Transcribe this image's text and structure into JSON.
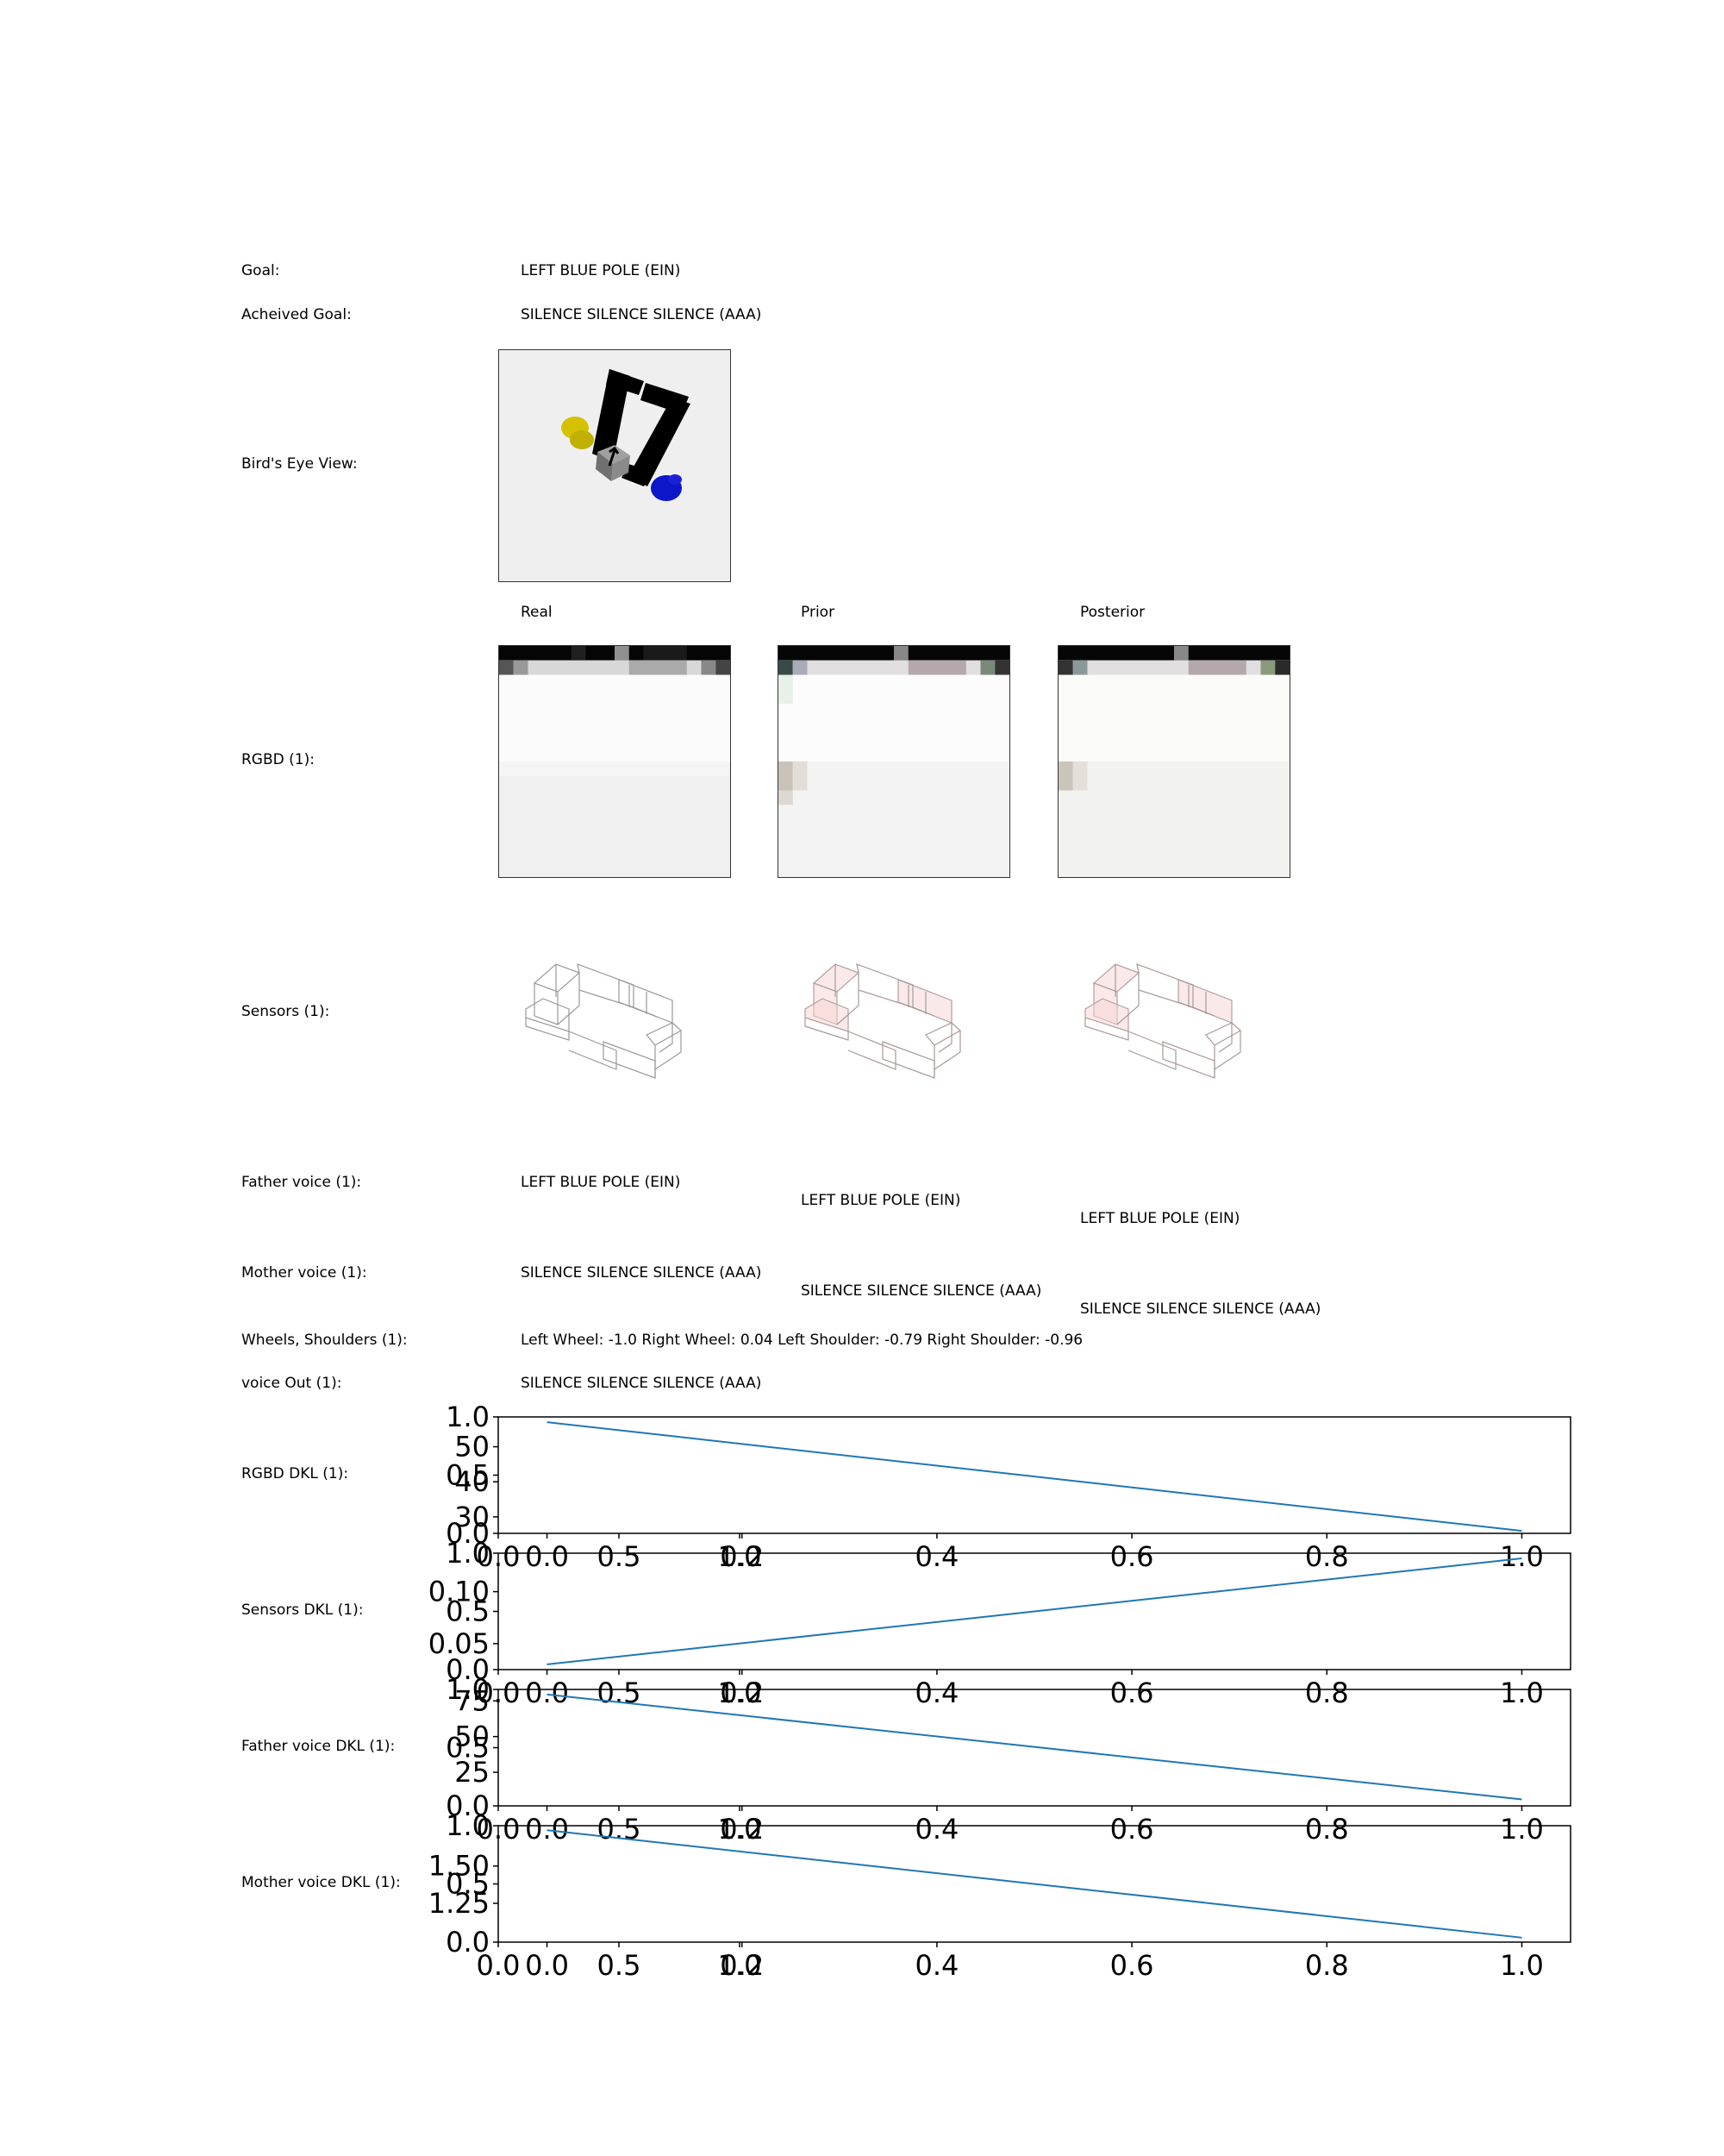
{
  "rows": {
    "goal": {
      "label": "Goal:",
      "value": "LEFT BLUE POLE (EIN)"
    },
    "achieved": {
      "label": "Acheived Goal:",
      "value": "SILENCE SILENCE SILENCE (AAA)"
    },
    "birds_eye": {
      "label": "Bird's Eye View:"
    },
    "columns": {
      "real": "Real",
      "prior": "Prior",
      "posterior": "Posterior"
    },
    "rgbd": {
      "label": "RGBD (1):"
    },
    "sensors": {
      "label": "Sensors (1):"
    },
    "father": {
      "label": "Father voice (1):",
      "real": "LEFT BLUE POLE (EIN)",
      "prior": "LEFT BLUE POLE (EIN)",
      "posterior": "LEFT BLUE POLE (EIN)"
    },
    "mother": {
      "label": "Mother voice (1):",
      "real": "SILENCE SILENCE SILENCE (AAA)",
      "prior": "SILENCE SILENCE SILENCE (AAA)",
      "posterior": "SILENCE SILENCE SILENCE (AAA)"
    },
    "wheels": {
      "label": "Wheels, Shoulders (1):",
      "value": "Left Wheel: -1.0 Right Wheel: 0.04 Left Shoulder: -0.79 Right Shoulder: -0.96"
    },
    "voice_out": {
      "label": "voice Out (1):",
      "value": "SILENCE SILENCE SILENCE (AAA)"
    }
  },
  "colors": {
    "line": "#1f77b4",
    "yellow_pole": "#d4c200",
    "blue_pole": "#0d16c9",
    "walls": "#000000",
    "agent": "#808080"
  },
  "chart_data": [
    {
      "type": "line",
      "label": "RGBD DKL (1):",
      "x": [
        0.0,
        1.0
      ],
      "y": [
        57,
        26
      ],
      "xlim": [
        -0.05,
        1.05
      ],
      "ylim": [
        25.3,
        58.5
      ],
      "yticks": [
        "30",
        "40",
        "50"
      ],
      "ytick_values": [
        30,
        40,
        50
      ],
      "xticks": [
        "0.0",
        "0.2",
        "0.4",
        "0.6",
        "0.8",
        "1.0"
      ],
      "xtick_values": [
        0.0,
        0.2,
        0.4,
        0.6,
        0.8,
        1.0
      ],
      "overlay_yticks": [
        "0.0",
        "0.5",
        "1.0"
      ],
      "overlay_xticks": [
        "0.0",
        "0.5",
        "1.0"
      ]
    },
    {
      "type": "line",
      "label": "Sensors DKL (1):",
      "x": [
        0.0,
        1.0
      ],
      "y": [
        0.03,
        0.132
      ],
      "xlim": [
        -0.05,
        1.05
      ],
      "ylim": [
        0.025,
        0.137
      ],
      "yticks": [
        "0.05",
        "0.10"
      ],
      "ytick_values": [
        0.05,
        0.1
      ],
      "xticks": [
        "0.0",
        "0.2",
        "0.4",
        "0.6",
        "0.8",
        "1.0"
      ],
      "xtick_values": [
        0.0,
        0.2,
        0.4,
        0.6,
        0.8,
        1.0
      ],
      "overlay_yticks": [
        "0.0",
        "0.5",
        "1.0"
      ],
      "overlay_xticks": [
        "0.0",
        "0.5",
        "1.0"
      ]
    },
    {
      "type": "line",
      "label": "Father voice DKL (1):",
      "x": [
        0.0,
        1.0
      ],
      "y": [
        79.5,
        6
      ],
      "xlim": [
        -0.05,
        1.05
      ],
      "ylim": [
        1.5,
        83
      ],
      "yticks": [
        "25",
        "50",
        "75"
      ],
      "ytick_values": [
        25,
        50,
        75
      ],
      "xticks": [
        "0.0",
        "0.2",
        "0.4",
        "0.6",
        "0.8",
        "1.0"
      ],
      "xtick_values": [
        0.0,
        0.2,
        0.4,
        0.6,
        0.8,
        1.0
      ],
      "overlay_yticks": [
        "0.0",
        "0.5",
        "1.0"
      ],
      "overlay_xticks": [
        "0.0",
        "0.5",
        "1.0"
      ]
    },
    {
      "type": "line",
      "label": "Mother voice DKL (1):",
      "x": [
        0.0,
        1.0
      ],
      "y": [
        1.74,
        1.02
      ],
      "xlim": [
        -0.05,
        1.05
      ],
      "ylim": [
        0.99,
        1.77
      ],
      "yticks": [
        "1.25",
        "1.50"
      ],
      "ytick_values": [
        1.25,
        1.5
      ],
      "xticks": [
        "0.0",
        "0.2",
        "0.4",
        "0.6",
        "0.8",
        "1.0"
      ],
      "xtick_values": [
        0.0,
        0.2,
        0.4,
        0.6,
        0.8,
        1.0
      ],
      "overlay_yticks": [
        "0.0",
        "0.5",
        "1.0"
      ],
      "overlay_xticks": [
        "0.0",
        "0.5",
        "1.0"
      ]
    }
  ]
}
